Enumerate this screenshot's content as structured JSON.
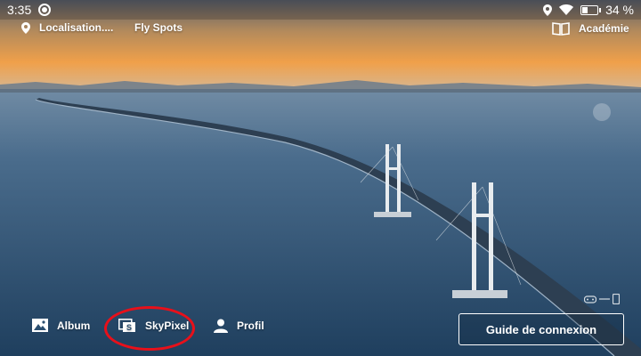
{
  "status_bar": {
    "time": "3:35",
    "battery": "34 %"
  },
  "top_nav": {
    "location_label": "Localisation....",
    "flyspots_label": "Fly Spots",
    "academy_label": "Académie"
  },
  "bottom_nav": {
    "album_label": "Album",
    "skypixel_label": "SkyPixel",
    "profile_label": "Profil"
  },
  "connection_guide_label": "Guide de connexion",
  "colors": {
    "annotation": "#e8101a",
    "sky_orange": "#f0a04a",
    "sea_blue": "#2b4f70"
  }
}
